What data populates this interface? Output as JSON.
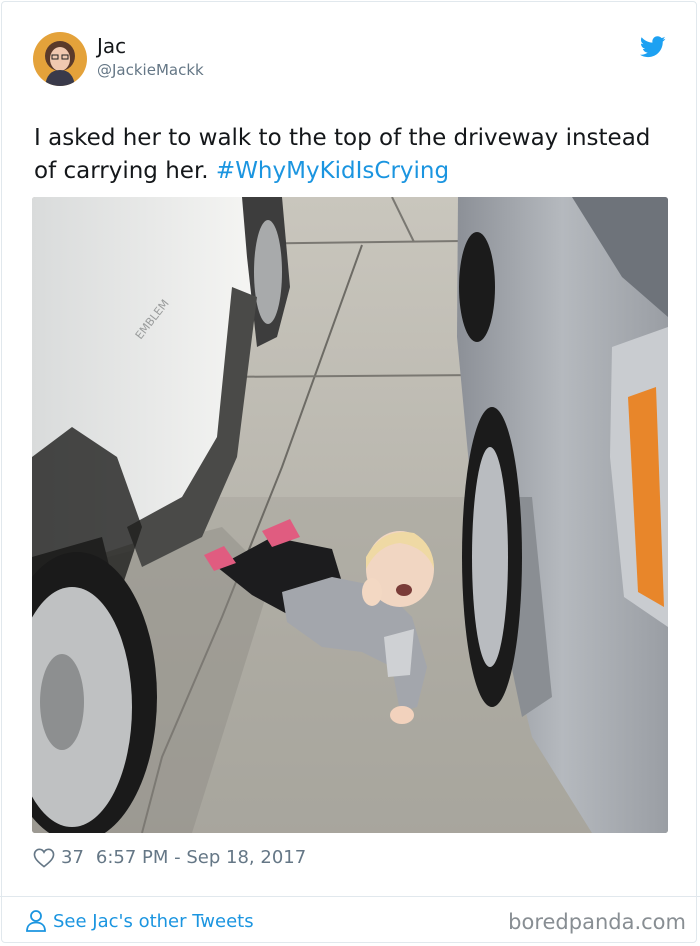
{
  "tweet": {
    "author_name": "Jac",
    "author_handle": "@JackieMackk",
    "text_main": "I asked her to walk to the top of the driveway instead of carrying her.",
    "hashtag": "#WhyMyKidIsCrying",
    "likes": "37",
    "timestamp": "6:57 PM - Sep 18, 2017"
  },
  "footer": {
    "link_label": "See Jac's other Tweets",
    "watermark": "boredpanda.com"
  },
  "icons": {
    "brand": "twitter-bird-icon",
    "like": "heart-icon",
    "profile": "user-icon"
  },
  "colors": {
    "link": "#1b95e0",
    "muted": "#657786",
    "text": "#14171a",
    "border": "#e1e8ed"
  }
}
